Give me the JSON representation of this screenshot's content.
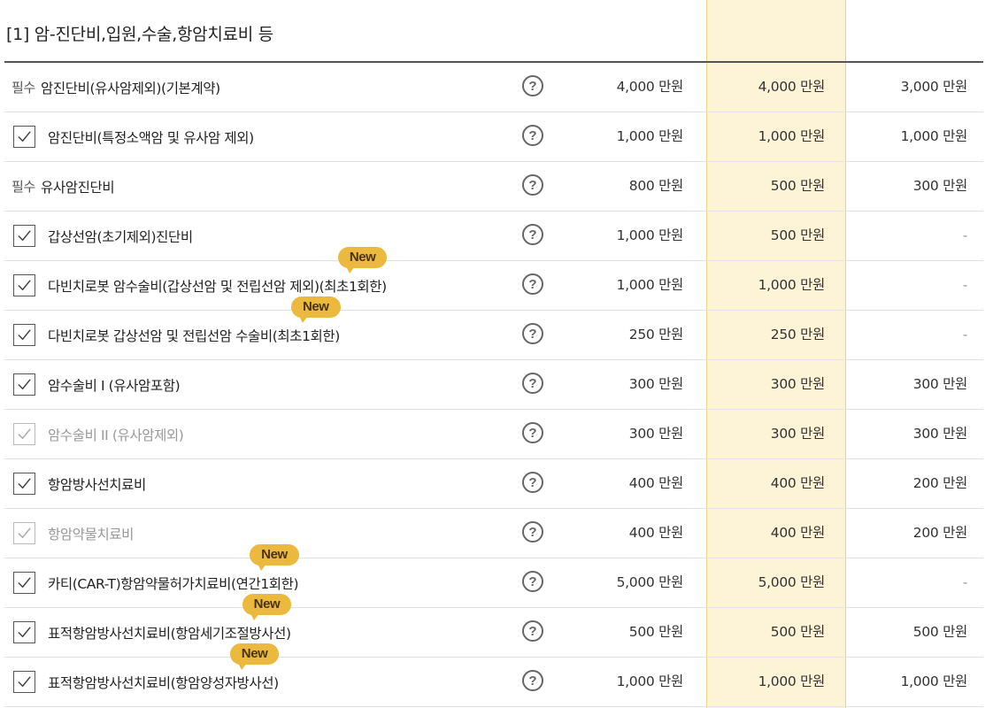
{
  "section": {
    "title": "[1] 암-진단비,입원,수술,항암치료비 등"
  },
  "colors": {
    "highlight_column": "#fdf3d6",
    "badge": "#ebb93e"
  },
  "rows": [
    {
      "required": "필수",
      "checkbox": false,
      "dim": false,
      "label": "암진단비(유사암제외)(기본계약)",
      "badge": "",
      "plan1": "4,000 만원",
      "plan2": "4,000 만원",
      "plan3": "3,000 만원"
    },
    {
      "required": "",
      "checkbox": true,
      "dim": false,
      "label": "암진단비(특정소액암 및 유사암 제외)",
      "badge": "",
      "plan1": "1,000 만원",
      "plan2": "1,000 만원",
      "plan3": "1,000 만원"
    },
    {
      "required": "필수",
      "checkbox": false,
      "dim": false,
      "label": "유사암진단비",
      "badge": "",
      "plan1": "800 만원",
      "plan2": "500 만원",
      "plan3": "300 만원"
    },
    {
      "required": "",
      "checkbox": true,
      "dim": false,
      "label": "갑상선암(초기제외)진단비",
      "badge": "",
      "plan1": "1,000 만원",
      "plan2": "500 만원",
      "plan3": "-"
    },
    {
      "required": "",
      "checkbox": true,
      "dim": false,
      "label": "다빈치로봇 암수술비(갑상선암 및 전립선암 제외)(최초1회한)",
      "badge": "New",
      "plan1": "1,000 만원",
      "plan2": "1,000 만원",
      "plan3": "-"
    },
    {
      "required": "",
      "checkbox": true,
      "dim": false,
      "label": "다빈치로봇 갑상선암 및 전립선암 수술비(최초1회한)",
      "badge": "New",
      "plan1": "250 만원",
      "plan2": "250 만원",
      "plan3": "-"
    },
    {
      "required": "",
      "checkbox": true,
      "dim": false,
      "label": "암수술비 I (유사암포함)",
      "badge": "",
      "plan1": "300 만원",
      "plan2": "300 만원",
      "plan3": "300 만원"
    },
    {
      "required": "",
      "checkbox": true,
      "dim": true,
      "label": "암수술비 II (유사암제외)",
      "badge": "",
      "plan1": "300 만원",
      "plan2": "300 만원",
      "plan3": "300 만원"
    },
    {
      "required": "",
      "checkbox": true,
      "dim": false,
      "label": "항암방사선치료비",
      "badge": "",
      "plan1": "400 만원",
      "plan2": "400 만원",
      "plan3": "200 만원"
    },
    {
      "required": "",
      "checkbox": true,
      "dim": true,
      "label": "항암약물치료비",
      "badge": "",
      "plan1": "400 만원",
      "plan2": "400 만원",
      "plan3": "200 만원"
    },
    {
      "required": "",
      "checkbox": true,
      "dim": false,
      "label": "카티(CAR-T)항암약물허가치료비(연간1회한)",
      "badge": "New",
      "plan1": "5,000 만원",
      "plan2": "5,000 만원",
      "plan3": "-"
    },
    {
      "required": "",
      "checkbox": true,
      "dim": false,
      "label": "표적항암방사선치료비(항암세기조절방사선)",
      "badge": "New",
      "plan1": "500 만원",
      "plan2": "500 만원",
      "plan3": "500 만원"
    },
    {
      "required": "",
      "checkbox": true,
      "dim": false,
      "label": "표적항암방사선치료비(항암양성자방사선)",
      "badge": "New",
      "plan1": "1,000 만원",
      "plan2": "1,000 만원",
      "plan3": "1,000 만원"
    }
  ],
  "help_glyph": "?"
}
